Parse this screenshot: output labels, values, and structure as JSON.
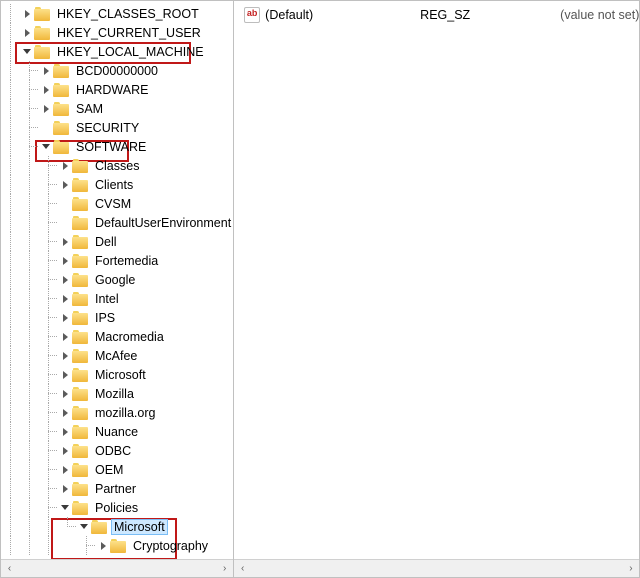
{
  "tree": {
    "root0": "HKEY_CLASSES_ROOT",
    "root1": "HKEY_CURRENT_USER",
    "root2": "HKEY_LOCAL_MACHINE",
    "hklm": {
      "bcd": "BCD00000000",
      "hardware": "HARDWARE",
      "sam": "SAM",
      "security": "SECURITY",
      "software": "SOFTWARE",
      "sw": {
        "classes": "Classes",
        "clients": "Clients",
        "cvsm": "CVSM",
        "due": "DefaultUserEnvironment",
        "dell": "Dell",
        "fortemedia": "Fortemedia",
        "google": "Google",
        "intel": "Intel",
        "ips": "IPS",
        "macromedia": "Macromedia",
        "mcafee": "McAfee",
        "microsoft": "Microsoft",
        "mozilla": "Mozilla",
        "mozillaorg": "mozilla.org",
        "nuance": "Nuance",
        "odbc": "ODBC",
        "oem": "OEM",
        "partner": "Partner",
        "policies": "Policies",
        "pol": {
          "microsoft": "Microsoft",
          "ms": {
            "cryptography": "Cryptography"
          }
        }
      }
    }
  },
  "values": {
    "default_name": "(Default)",
    "default_type": "REG_SZ",
    "default_data": "(value not set)"
  }
}
